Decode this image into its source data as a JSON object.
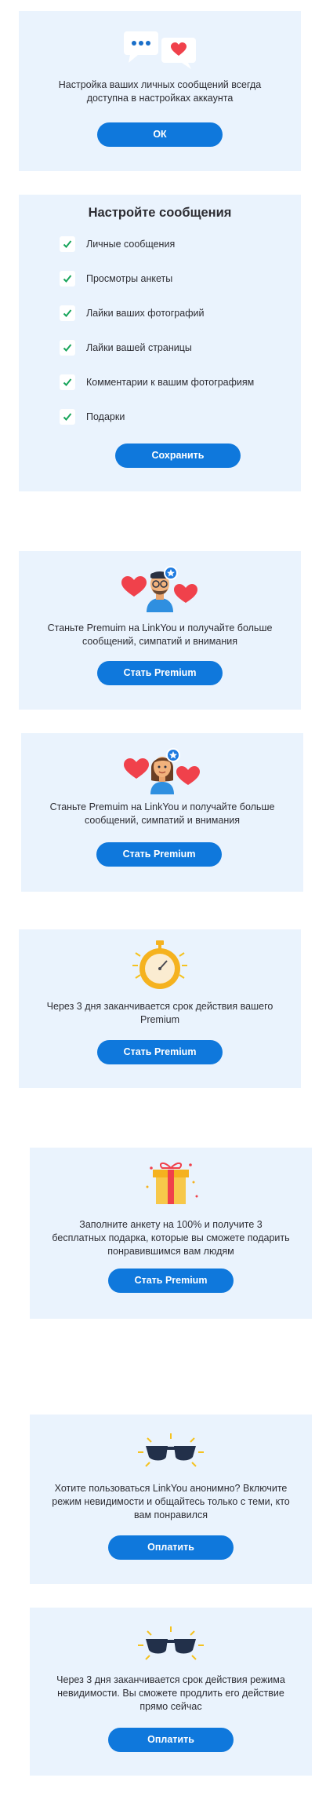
{
  "colors": {
    "card_bg": "#eaf3fd",
    "button_bg": "#0f78dc",
    "button_text": "#ffffff",
    "check_color": "#17a45a",
    "heart": "#f0414b"
  },
  "message_notice": {
    "text": "Настройка ваших личных сообщений всегда доступна в настройках аккаунта",
    "button": "ОК",
    "icon": "chat-bubbles-icon"
  },
  "message_settings": {
    "title": "Настройте сообщения",
    "options": [
      {
        "label": "Личные сообщения",
        "checked": true
      },
      {
        "label": "Просмотры анкеты",
        "checked": true
      },
      {
        "label": "Лайки ваших фотографий",
        "checked": true
      },
      {
        "label": "Лайки вашей страницы",
        "checked": true
      },
      {
        "label": "Комментарии к вашим фотографиям",
        "checked": true
      },
      {
        "label": "Подарки",
        "checked": true
      }
    ],
    "save_button": "Сохранить"
  },
  "premium_male": {
    "text": "Станьте Premuim на LinkYou и получайте больше сообщений, симпатий и внимания",
    "button": "Стать Premium",
    "icon": "man-avatar-with-hearts-icon"
  },
  "premium_female": {
    "text": "Станьте Premuim на LinkYou и получайте больше сообщений, симпатий и внимания",
    "button": "Стать Premium",
    "icon": "woman-avatar-with-hearts-icon"
  },
  "premium_expiring": {
    "text": "Через 3 дня заканчивается срок действия вашего Premium",
    "button": "Стать Premium",
    "icon": "stopwatch-icon"
  },
  "profile_gifts": {
    "text": "Заполните анкету на 100% и получите 3 бесплатных подарка, которые вы сможете подарить понравившимся вам людям",
    "button": "Стать Premium",
    "icon": "gift-box-icon"
  },
  "invisible_mode": {
    "text": "Хотите пользоваться LinkYou анонимно? Включите режим невидимости и общайтесь только с теми, кто вам понравился",
    "button": "Оплатить",
    "icon": "sunglasses-icon"
  },
  "invisible_expiring": {
    "text": "Через 3 дня заканчивается срок действия режима невидимости. Вы сможете продлить его действие прямо сейчас",
    "button": "Оплатить",
    "icon": "sunglasses-icon"
  }
}
